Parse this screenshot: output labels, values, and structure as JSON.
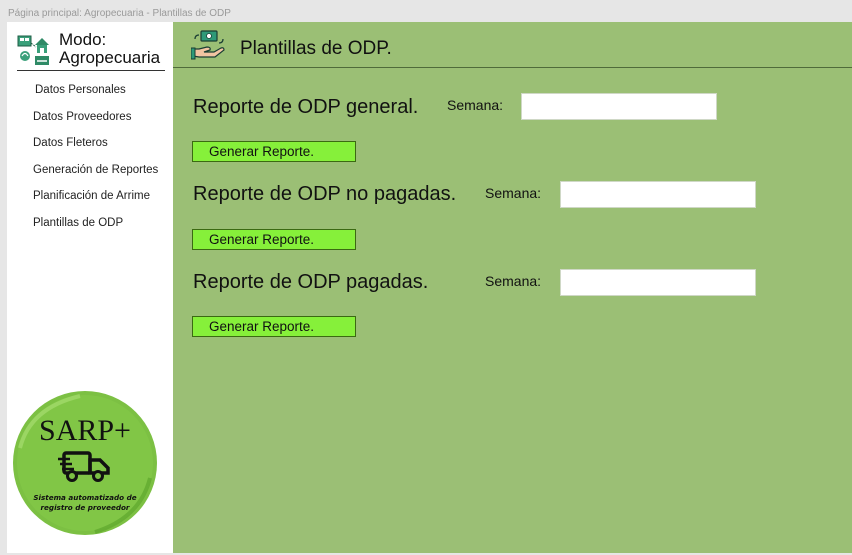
{
  "window": {
    "title": "Página principal: Agropecuaria - Plantillas de ODP"
  },
  "sidebar": {
    "mode_line1": "Modo:",
    "mode_line2": "Agropecuaria",
    "items": [
      {
        "label": "Datos Personales"
      },
      {
        "label": "Datos Proveedores"
      },
      {
        "label": "Datos Fleteros"
      },
      {
        "label": "Generación de Reportes"
      },
      {
        "label": "Planificación de Arrime"
      },
      {
        "label": "Plantillas de ODP"
      }
    ],
    "logo": {
      "title": "SARP+",
      "subtitle_line1": "Sistema automatizado de",
      "subtitle_line2": "registro de proveedor",
      "circle_color": "#7cc043"
    }
  },
  "main": {
    "title": "Plantillas de ODP.",
    "background": "#9bbf75",
    "reports": [
      {
        "title": "Reporte de ODP general.",
        "week_label": "Semana:",
        "week_value": "",
        "button_label": "Generar Reporte."
      },
      {
        "title": "Reporte de ODP no pagadas.",
        "week_label": "Semana:",
        "week_value": "",
        "button_label": "Generar Reporte."
      },
      {
        "title": "Reporte de ODP pagadas.",
        "week_label": "Semana:",
        "week_value": "",
        "button_label": "Generar Reporte."
      }
    ],
    "button_color": "#86f03a"
  },
  "icons": {
    "mode": "farm-icon",
    "header": "money-hand-icon",
    "logo": "truck-icon"
  }
}
